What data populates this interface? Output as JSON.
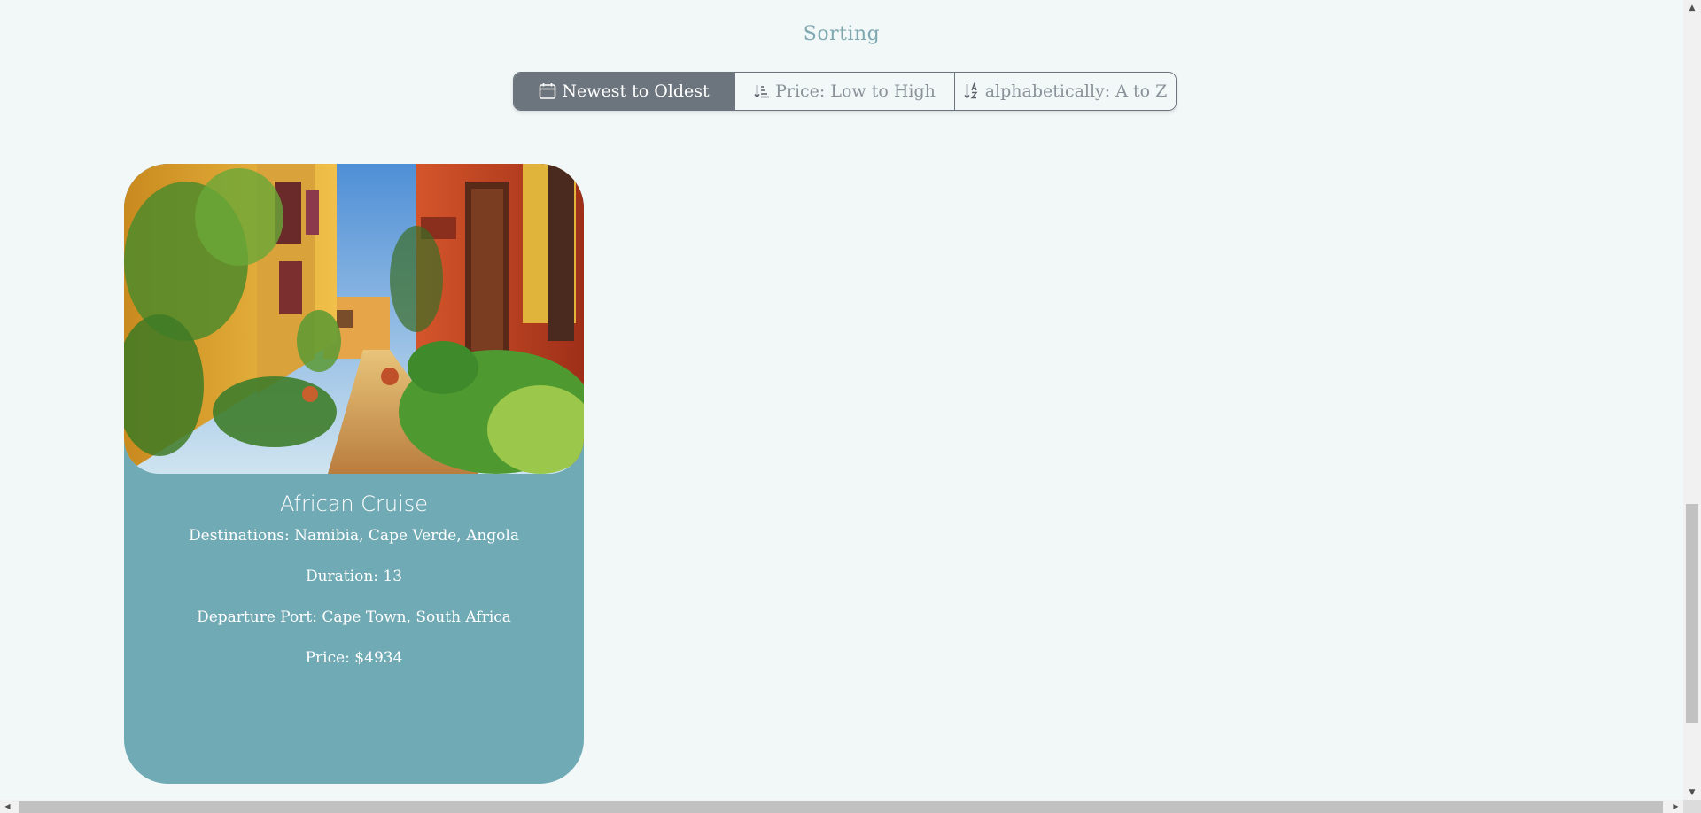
{
  "sorting": {
    "title": "Sorting",
    "options": [
      {
        "label": "Newest to Oldest",
        "icon": "calendar-icon",
        "active": true
      },
      {
        "label": "Price: Low to High",
        "icon": "sort-amount-down-icon",
        "active": false
      },
      {
        "label": "alphabetically: A to Z",
        "icon": "sort-alpha-down-icon",
        "active": false
      }
    ]
  },
  "cards": [
    {
      "title": "African Cruise",
      "destinations": "Destinations: Namibia, Cape Verde, Angola",
      "duration": "Duration: 13",
      "departure_port": "Departure Port: Cape Town, South Africa",
      "price": "Price: $4934",
      "image": "colorful-alley-photo"
    }
  ],
  "colors": {
    "background": "#f2f8f8",
    "card": "#70aab4",
    "active_button": "#6c757d",
    "sorting_title": "#7fa8b0"
  },
  "scrollbars": {
    "up_arrow": "▲",
    "down_arrow": "▼",
    "left_arrow": "◀",
    "right_arrow": "▶"
  }
}
